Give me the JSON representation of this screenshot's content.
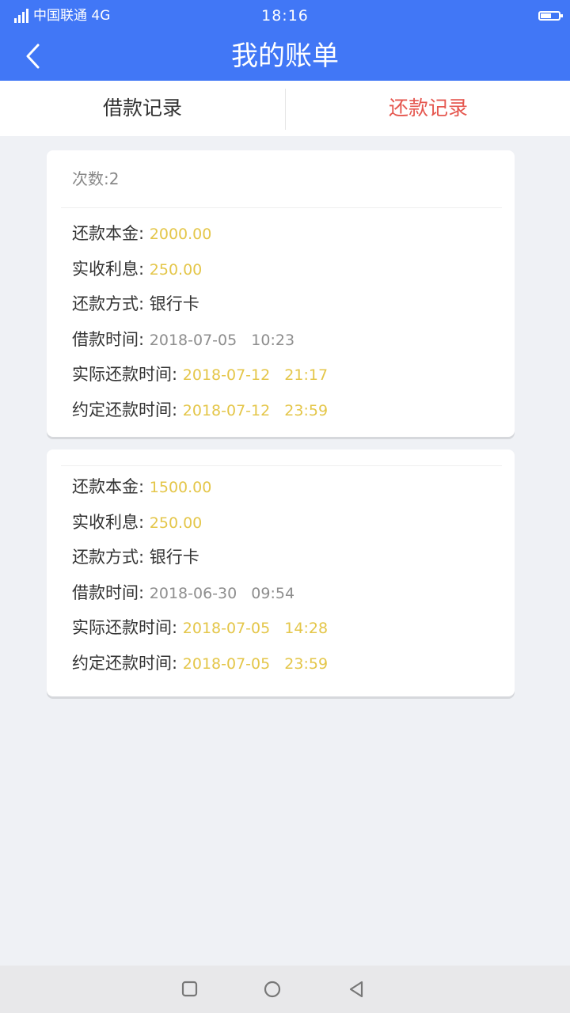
{
  "status": {
    "carrier": "中国联通 4G",
    "time": "18:16",
    "battery_level": 0.55
  },
  "nav": {
    "title": "我的账单"
  },
  "tabs": [
    {
      "label": "借款记录"
    },
    {
      "label": "还款记录"
    }
  ],
  "cards": [
    {
      "count_label": "次数:2",
      "rows": [
        {
          "label": "还款本金:",
          "value": "2000.00"
        },
        {
          "label": "实收利息:",
          "value": "250.00"
        },
        {
          "label": "还款方式:",
          "value": "银行卡"
        },
        {
          "label": "借款时间:",
          "value": "2018-07-05   10:23"
        },
        {
          "label": "实际还款时间:",
          "value": "2018-07-12   21:17"
        },
        {
          "label": "约定还款时间:",
          "value": "2018-07-12   23:59"
        }
      ]
    },
    {
      "rows": [
        {
          "label": "还款本金:",
          "value": "1500.00"
        },
        {
          "label": "实收利息:",
          "value": "250.00"
        },
        {
          "label": "还款方式:",
          "value": "银行卡"
        },
        {
          "label": "借款时间:",
          "value": "2018-06-30   09:54"
        },
        {
          "label": "实际还款时间:",
          "value": "2018-07-05   14:28"
        },
        {
          "label": "约定还款时间:",
          "value": "2018-07-05   23:59"
        }
      ]
    }
  ],
  "colors": {
    "primary": "#4177f6",
    "active_tab": "#e5574f",
    "amount": "#e4c649",
    "muted": "#8e8e8e"
  },
  "icons": {
    "back": "chevron-left-icon",
    "signal": "signal-icon",
    "battery": "battery-icon",
    "recents": "square-icon",
    "home": "circle-icon",
    "back_nav": "triangle-left-icon"
  }
}
